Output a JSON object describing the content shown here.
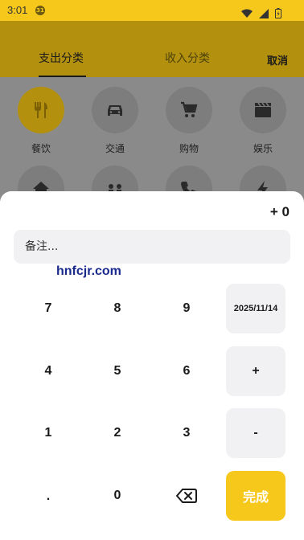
{
  "status_bar": {
    "time": "3:01",
    "notification_badge": "31"
  },
  "header": {
    "tabs": [
      {
        "label": "支出分类",
        "active": true
      },
      {
        "label": "收入分类",
        "active": false
      }
    ],
    "cancel_label": "取消"
  },
  "categories": [
    {
      "label": "餐饮",
      "icon": "fork-knife-icon"
    },
    {
      "label": "交通",
      "icon": "car-icon"
    },
    {
      "label": "购物",
      "icon": "cart-icon"
    },
    {
      "label": "娱乐",
      "icon": "clapperboard-icon"
    }
  ],
  "sheet": {
    "amount": "+ 0",
    "note_placeholder": "备注...",
    "watermark": "hnfcjr.com",
    "keypad": {
      "row1": [
        "7",
        "8",
        "9"
      ],
      "date": "2025/11/14",
      "row2": [
        "4",
        "5",
        "6"
      ],
      "plus": "+",
      "row3": [
        "1",
        "2",
        "3"
      ],
      "minus": "-",
      "dot": ".",
      "zero": "0",
      "backspace_icon": "backspace-icon",
      "done": "完成"
    }
  },
  "colors": {
    "accent": "#f7c81c",
    "dimmed_header": "#b3900e",
    "overlay": "#8a8a8a",
    "key_gray": "#f1f1f3"
  }
}
